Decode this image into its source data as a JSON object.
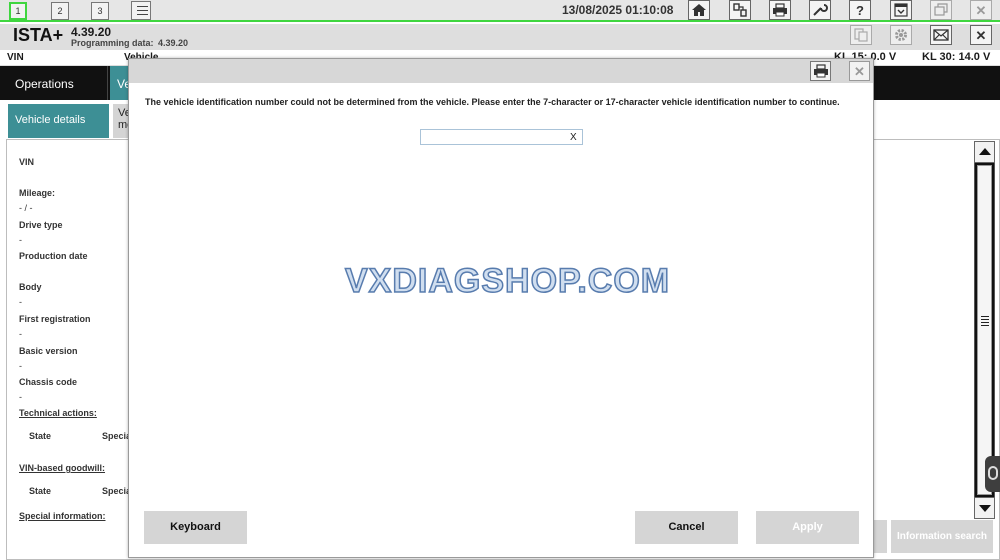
{
  "toolbar": {
    "tabs": [
      "1",
      "2",
      "3"
    ],
    "datetime": "13/08/2025 01:10:08",
    "icons": [
      "list-icon",
      "home-icon",
      "connection-icon",
      "print-icon",
      "wrench-icon",
      "help-icon",
      "download-icon",
      "windows-icon",
      "close-icon"
    ],
    "help_glyph": "?",
    "close_glyph": "✕"
  },
  "header": {
    "title": "ISTA+",
    "version": "4.39.20",
    "programming_label": "Programming data:",
    "programming_value": "4.39.20",
    "close_glyph": "✕"
  },
  "infobar": {
    "vin_label": "VIN",
    "vehicle_label": "Vehicle",
    "kl15": "KL 15:  0.0 V",
    "kl30": "KL 30:   14.0 V"
  },
  "nav": {
    "operations": "Operations",
    "vehicle": "Vehicle"
  },
  "subtabs": {
    "vehicle_details": "Vehicle details",
    "second": "Ve mo"
  },
  "details": {
    "vin": "VIN",
    "mileage_label": "Mileage:",
    "mileage_value": "- / -",
    "drive_type_label": "Drive type",
    "drive_type_value": "-",
    "production_date_label": "Production date",
    "body_label": "Body",
    "body_value": "-",
    "first_registration_label": "First registration",
    "first_registration_value": "-",
    "basic_version_label": "Basic version",
    "basic_version_value": "-",
    "chassis_code_label": "Chassis code",
    "chassis_code_value": "-",
    "technical_actions": "Technical actions:",
    "state": "State",
    "special": "Specia",
    "vin_goodwill": "VIN-based goodwill:",
    "state2": "State",
    "special2": "Specia",
    "special_information": "Special information:"
  },
  "background_buttons": {
    "information_search": "Information search"
  },
  "modal": {
    "message": "The vehicle identification number could not be determined from the vehicle. Please enter the 7-character or 17-character vehicle identification number to continue.",
    "vin_input_value": "",
    "vin_input_placeholder": "",
    "clear_glyph": "X",
    "close_glyph": "✕",
    "keyboard": "Keyboard",
    "cancel": "Cancel",
    "apply": "Apply"
  },
  "watermark": "VXDIAGSHOP.COM",
  "colors": {
    "accent_green": "#3fd63f",
    "teal": "#3d8f95",
    "nav_dark": "#111111"
  }
}
